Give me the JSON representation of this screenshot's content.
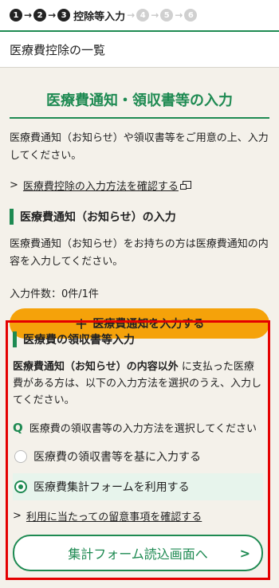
{
  "stepper": {
    "steps": [
      {
        "num": "1",
        "state": "done"
      },
      {
        "num": "2",
        "state": "done"
      },
      {
        "num": "3",
        "state": "current",
        "label": "控除等入力"
      },
      {
        "num": "4",
        "state": "todo"
      },
      {
        "num": "5",
        "state": "todo"
      },
      {
        "num": "6",
        "state": "todo"
      }
    ],
    "arrow": "→"
  },
  "breadcrumb": "医療費控除の一覧",
  "page_heading": "医療費通知・領収書等の入力",
  "intro": "医療費通知（お知らせ）や領収書等をご用意の上、入力してください。",
  "howto_link": "医療費控除の入力方法を確認する",
  "notice_section": {
    "title": "医療費通知（お知らせ）の入力",
    "description": "医療費通知（お知らせ）をお持ちの方は医療費通知の内容を入力してください。",
    "count_label": "入力件数：0件/1件",
    "add_button": "医療費通知を入力する"
  },
  "receipt_section": {
    "title": "医療費の領収書等入力",
    "description_bold": "医療費通知（お知らせ）の内容以外",
    "description_rest": " に支払った医療費がある方は、以下の入力方法を選択のうえ、入力してください。",
    "question_mark": "Q",
    "question": "医療費の領収書等の入力方法を選択してください",
    "options": [
      {
        "label": "医療費の領収書等を基に入力する",
        "selected": false
      },
      {
        "label": "医療費集計フォームを利用する",
        "selected": true
      }
    ],
    "notes_link": "利用に当たっての留意事項を確認する",
    "next_button": "集計フォーム読込画面へ"
  }
}
